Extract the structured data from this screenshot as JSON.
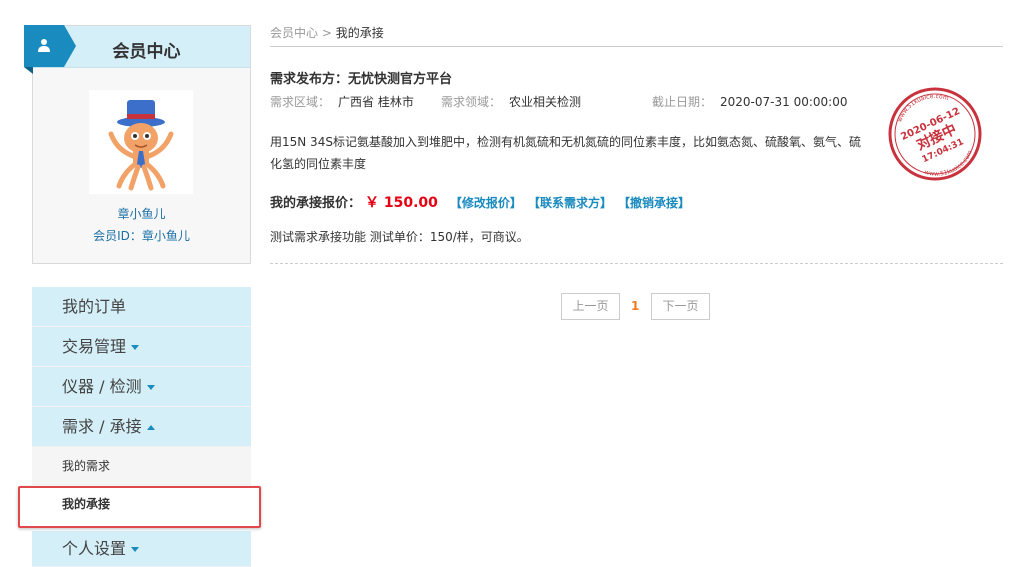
{
  "sidebar": {
    "header_title": "会员中心",
    "member_name": "章小鱼儿",
    "member_id": "会员ID：章小鱼儿",
    "menu": [
      {
        "label": "我的订单"
      },
      {
        "label": "交易管理"
      },
      {
        "label": "仪器 / 检测"
      },
      {
        "label": "需求 / 承接"
      },
      {
        "label": "我的需求"
      },
      {
        "label": "我的承接"
      },
      {
        "label": "个人设置"
      }
    ]
  },
  "breadcrumb": {
    "root": "会员中心",
    "sep": ">",
    "current": "我的承接"
  },
  "request": {
    "title": "需求发布方：无忧快测官方平台",
    "region_key": "需求区域：",
    "region_val": "广西省 桂林市",
    "field_key": "需求领域：",
    "field_val": "农业相关检测",
    "deadline_key": "截止日期：",
    "deadline_val": "2020-07-31 00:00:00",
    "description": "用15N 34S标记氨基酸加入到堆肥中，检测有机氮硫和无机氮硫的同位素丰度，比如氨态氮、硫酸氧、氨气、硫化氢的同位素丰度",
    "quote_label": "我的承接报价：",
    "quote_price": "￥ 150.00",
    "actions": [
      "【修改报价】",
      "【联系需求方】",
      "【撤销承接】"
    ],
    "note": "测试需求承接功能 测试单价：150/样，可商议。"
  },
  "stamp": {
    "date": "2020-06-12",
    "status": "对接中",
    "time": "17:04:31",
    "ring_text": "www.51kuaice.com",
    "color": "#c8323c"
  },
  "pager": {
    "prev": "上一页",
    "current": "1",
    "next": "下一页"
  },
  "colors": {
    "accent": "#1a8bbf",
    "sidebar_bg": "#d4eff8",
    "price": "#e60012",
    "highlight": "#e0484b"
  }
}
